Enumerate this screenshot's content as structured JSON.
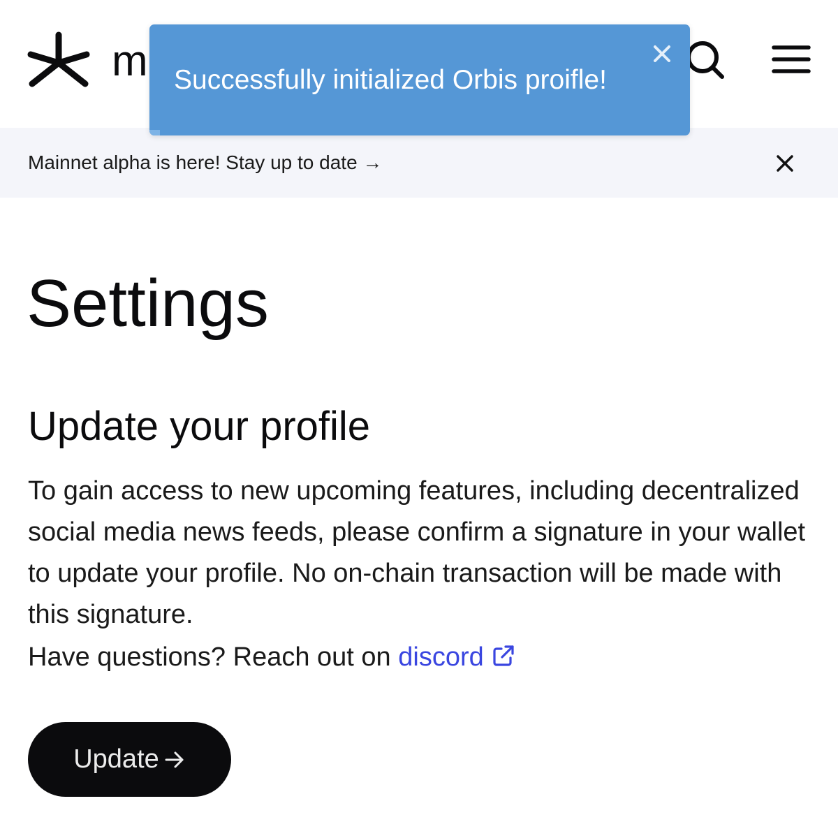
{
  "header": {
    "logo_text": "m",
    "logo_icon": "asterisk-logo-icon",
    "search_icon": "search-icon",
    "menu_icon": "hamburger-menu-icon"
  },
  "banner": {
    "text": "Mainnet alpha is here! Stay up to date →",
    "close_icon": "close-icon",
    "background": "#f4f5fa"
  },
  "toast": {
    "message": "Successfully initialized Orbis proifle!",
    "close_label": "×",
    "background": "#5597d6",
    "progress": 0.02
  },
  "main": {
    "title": "Settings",
    "section_title": "Update your profile",
    "description": "To gain access to new upcoming features, including decentralized social media news feeds, please confirm a signature in your wallet to update your profile. No on-chain transaction will be made with this signature.",
    "help_prefix": "Have questions? Reach out on ",
    "help_link": "discord",
    "link_color": "#3a46e0",
    "update_button": "Update"
  }
}
